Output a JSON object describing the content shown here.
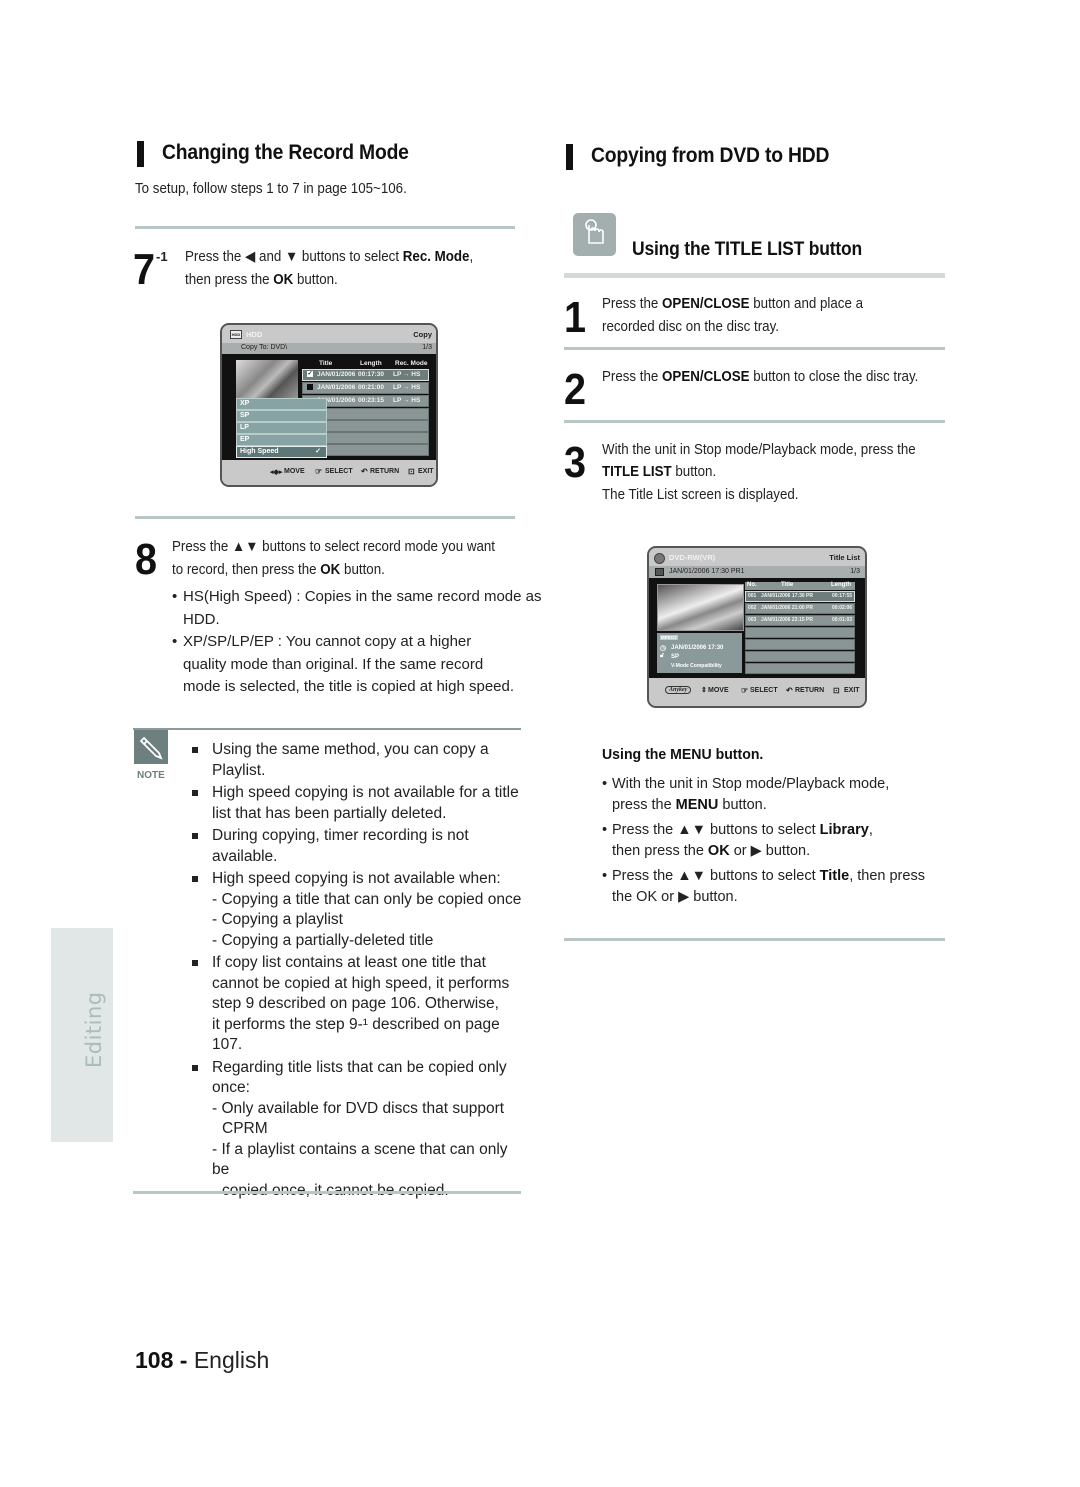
{
  "left": {
    "section_title": "Changing the Record Mode",
    "intro": "To setup, follow steps 1 to 7 in page 105~106.",
    "step7": {
      "num": "7",
      "sup": "-1",
      "line1_a": "Press the ",
      "line1_arrow1": "◀",
      "line1_b": " and ",
      "line1_arrow2": "▼",
      "line1_c": " buttons to select ",
      "line1_bold": "Rec. Mode",
      "line1_d": ",",
      "line2_a": "then press the ",
      "line2_bold": "OK",
      "line2_b": " button."
    },
    "osd_copy": {
      "source": "HDD",
      "mode_title": "Copy",
      "copy_to": "Copy To: DVD\\",
      "page": "1/3",
      "col_title": "Title",
      "col_length": "Length",
      "col_rec_mode": "Rec. Mode",
      "rows": [
        {
          "checked": true,
          "title": "JAN/01/2006",
          "length": "00:17:30",
          "mode": "LP → HS"
        },
        {
          "checked": false,
          "title": "JAN/01/2006",
          "length": "00:21:00",
          "mode": "LP → HS"
        },
        {
          "checked": null,
          "title": "JAN/01/2006",
          "length": "00:23:15",
          "mode": "LP → HS"
        }
      ],
      "menu_options": [
        "XP",
        "SP",
        "LP",
        "EP",
        "High Speed"
      ],
      "menu_selected": "High Speed",
      "check_mark": "✓",
      "footer": {
        "move": "MOVE",
        "select": "SELECT",
        "return": "RETURN",
        "exit": "EXIT"
      }
    },
    "step8": {
      "num": "8",
      "line1_a": "Press the ",
      "line1_arrows": "▲▼",
      "line1_b": " buttons to select record mode you want",
      "line2_a": "to record, then press the ",
      "line2_bold": "OK",
      "line2_b": " button.",
      "bullets": [
        [
          "HS(High Speed) : Copies in the same record mode as",
          "HDD."
        ],
        [
          "XP/SP/LP/EP : You cannot copy at a higher",
          "quality mode than original. If the same record",
          "mode is selected, the title is copied at high speed."
        ]
      ]
    },
    "note": {
      "label": "NOTE",
      "items": [
        {
          "lines": [
            "Using the same method, you can copy a",
            "Playlist."
          ],
          "sub": []
        },
        {
          "lines": [
            "High speed copying is not available for a title",
            "list that has been partially deleted."
          ],
          "sub": []
        },
        {
          "lines": [
            "During copying, timer recording is not",
            "available."
          ],
          "sub": []
        },
        {
          "lines": [
            "High speed copying is not available when:"
          ],
          "sub": [
            [
              "- Copying a title that can only be copied once"
            ],
            [
              "- Copying a playlist"
            ],
            [
              "- Copying a partially-deleted title"
            ]
          ]
        },
        {
          "lines": [
            "If copy list contains at least one title that",
            "cannot be copied at high speed, it performs",
            "step 9 described on page 106. Otherwise,",
            "it performs the step 9-¹ described on page",
            "107."
          ],
          "sub": []
        },
        {
          "lines": [
            "Regarding title lists that can be copied only",
            "once:"
          ],
          "sub": [
            [
              "- Only available for DVD discs that support",
              "CPRM"
            ],
            [
              "- If a playlist contains a scene that can only be",
              "copied once, it cannot be copied."
            ]
          ]
        }
      ]
    }
  },
  "right": {
    "section_title": "Copying from DVD to HDD",
    "sub_title": "Using the TITLE LIST button",
    "steps": [
      {
        "num": "1",
        "lines": [
          [
            "Press the ",
            "OPEN/CLOSE",
            " button and place a"
          ],
          [
            "recorded disc on the disc tray.",
            "",
            ""
          ]
        ]
      },
      {
        "num": "2",
        "lines": [
          [
            "Press the ",
            "OPEN/CLOSE",
            " button to close the disc tray."
          ]
        ]
      },
      {
        "num": "3",
        "lines": [
          [
            "With the unit in Stop mode/Playback mode, press the",
            "",
            ""
          ],
          [
            "",
            "TITLE LIST",
            " button."
          ],
          [
            "The Title List screen is displayed.",
            "",
            ""
          ]
        ]
      }
    ],
    "osd_title_list": {
      "source": "DVD-RW(VR)",
      "mode_title": "Title List",
      "info": "JAN/01/2006 17:30 PR1",
      "page": "1/3",
      "col_no": "No.",
      "col_title": "Title",
      "col_length": "Length",
      "rows": [
        {
          "no": "001",
          "title": "JAN/01/2006 17:30 PR",
          "length": "00:17:55"
        },
        {
          "no": "002",
          "title": "JAN/01/2006 21:00 PR",
          "length": "00:02:06"
        },
        {
          "no": "003",
          "title": "JAN/01/2006 23:15 PR",
          "length": "00:01:03"
        }
      ],
      "info_badge": "MPEG2",
      "info_date": "JAN/01/2006 17:30",
      "info_mode": "SP",
      "info_compat": "V-Mode Compatibility",
      "footer": {
        "anykey": "Anykey",
        "move": "MOVE",
        "select": "SELECT",
        "return": "RETURN",
        "exit": "EXIT"
      }
    },
    "menu_section": {
      "title": "Using the MENU button.",
      "bullets": [
        [
          [
            "With the unit in Stop mode/Playback mode,",
            "",
            ""
          ],
          [
            "press the ",
            "MENU",
            " button."
          ]
        ],
        [
          [
            "Press the ▲▼ buttons to select ",
            "Library",
            ","
          ],
          [
            "then press the ",
            "OK",
            " or ▶ button."
          ]
        ],
        [
          [
            "Press the ▲▼ buttons to select ",
            "Title",
            ", then press"
          ],
          [
            "the OK or ▶ button.",
            "",
            ""
          ]
        ]
      ]
    }
  },
  "side_tab": "Editing",
  "footer": {
    "page_num": "108",
    "sep": " - ",
    "lang": "English"
  }
}
